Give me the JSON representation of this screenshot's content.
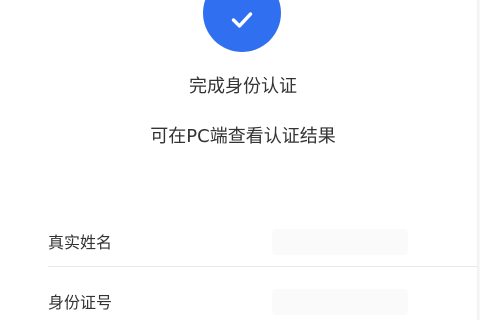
{
  "status": {
    "icon": "check-icon",
    "accent_color": "#2f6ff0",
    "title": "完成身份认证",
    "hint": "可在PC端查看认证结果"
  },
  "form": {
    "fields": [
      {
        "label": "真实姓名"
      },
      {
        "label": "身份证号"
      }
    ]
  }
}
